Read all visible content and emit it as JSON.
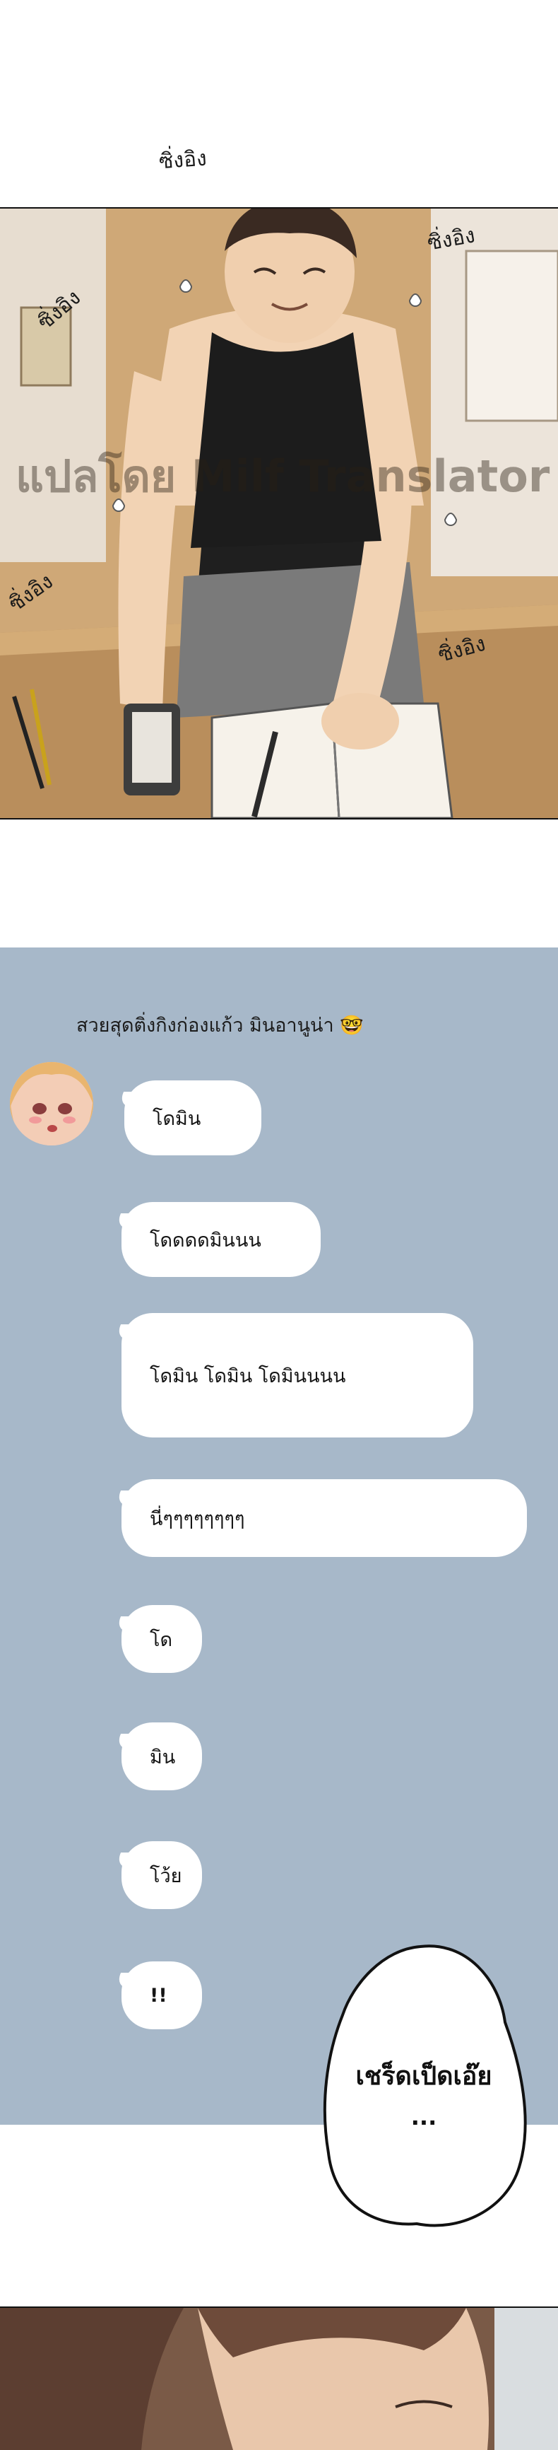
{
  "sfx": {
    "top": "ซิ่งอิง",
    "right_upper": "ซิ่งอิง",
    "left_upper": "ซิ่งอิง",
    "left_lower": "ซิ่งอิง",
    "right_lower": "ซิ่งอิง"
  },
  "watermark": "แปลโดย Milf Translator",
  "chat": {
    "title": "สวยสุดติ่งกิงก่องแก้ว มินอานูน่า",
    "title_emoji": "🤓",
    "messages": [
      "โดมิน",
      "โดดดดมินนน",
      "โดมิน โดมิน โดมินนนน",
      "นี่ๆๆๆๆๆๆๆๆ",
      "โด",
      "มิน",
      "โว้ย",
      "!!"
    ]
  },
  "shout": {
    "line1": "เชร็ดเป็ดเอ๊ย",
    "line2": "..."
  },
  "colors": {
    "chat_background": "#a7b8c9",
    "bubble": "#ffffff",
    "text": "#151515"
  }
}
